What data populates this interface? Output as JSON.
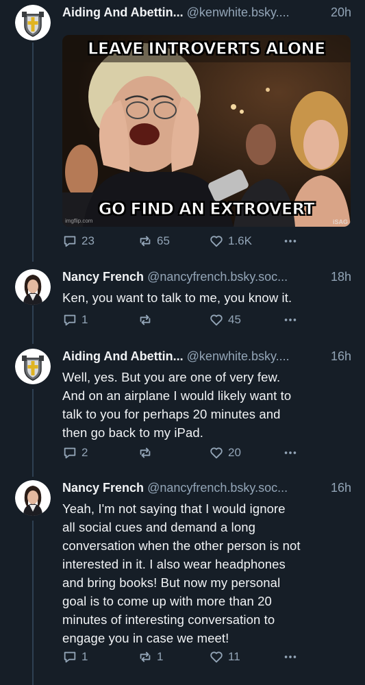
{
  "posts": [
    {
      "author": "Aiding And Abettin...",
      "handle": "@kenwhite.bsky....",
      "time": "20h",
      "avatar_icon": "shield-cross-icon",
      "text_lines": [],
      "embed": {
        "top_caption": "LEAVE INTROVERTS ALONE",
        "bottom_caption": "GO FIND AN EXTROVERT",
        "watermark_left": "imgflip.com",
        "watermark_right": "iSAG"
      },
      "replies": "23",
      "reposts": "65",
      "likes": "1.6K"
    },
    {
      "author": "Nancy French",
      "handle": "@nancyfrench.bsky.soc...",
      "time": "18h",
      "avatar_icon": "profile-photo-icon",
      "text_lines": [
        "Ken, you want to talk to me, you know it."
      ],
      "replies": "1",
      "reposts": "",
      "likes": "45"
    },
    {
      "author": "Aiding And Abettin...",
      "handle": "@kenwhite.bsky....",
      "time": "16h",
      "avatar_icon": "shield-cross-icon",
      "text_lines": [
        "Well, yes.  But you are one of very few.",
        "And on an airplane I would likely want to",
        "talk to you for perhaps 20 minutes and",
        "then go back to my iPad."
      ],
      "replies": "2",
      "reposts": "",
      "likes": "20"
    },
    {
      "author": "Nancy French",
      "handle": "@nancyfrench.bsky.soc...",
      "time": "16h",
      "avatar_icon": "profile-photo-icon",
      "text_lines": [
        "Yeah, I'm not saying that I would ignore",
        "all social cues and demand a long",
        "conversation when the other person is not",
        "interested in it.  I also wear headphones",
        "and bring books!  But now my personal",
        "goal is to come up with more than 20",
        "minutes of interesting conversation to",
        "engage you in case we meet!"
      ],
      "replies": "1",
      "reposts": "1",
      "likes": "11"
    }
  ],
  "colors": {
    "background": "#161e27",
    "text": "#f1f3f5",
    "muted": "#93a5b7",
    "thread_line": "#2e4052"
  }
}
